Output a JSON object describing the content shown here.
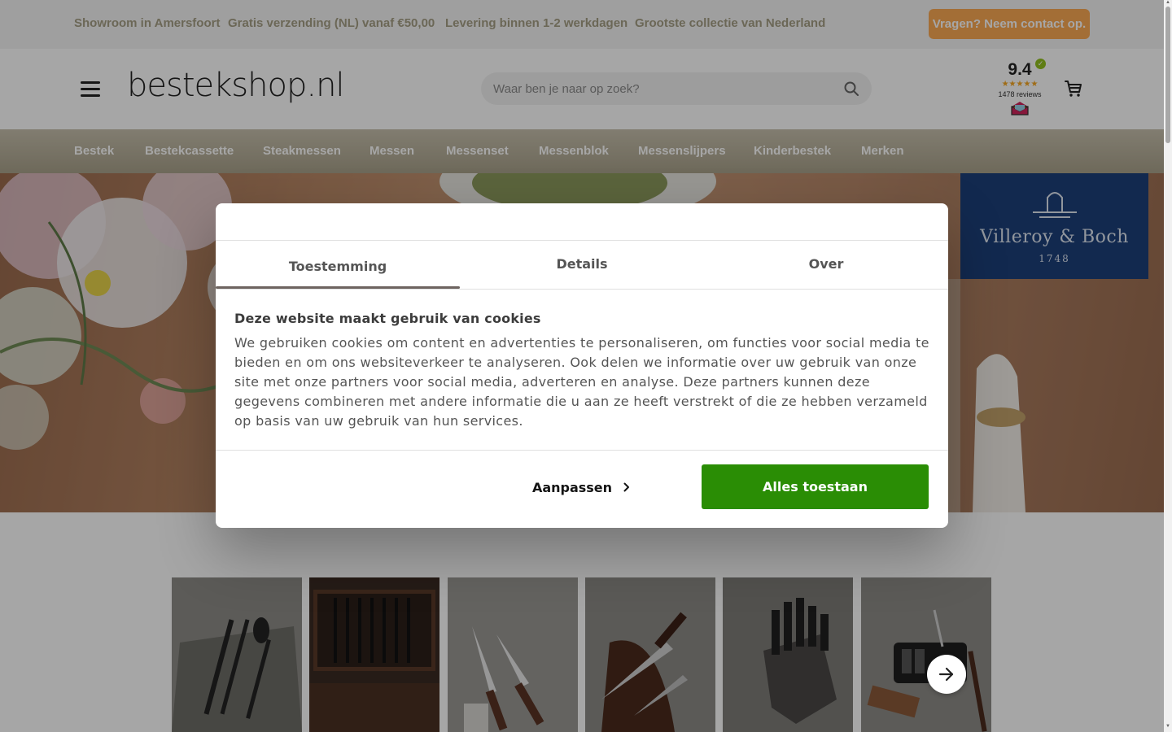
{
  "topbar": {
    "usps": [
      "Showroom in Amersfoort",
      "Gratis verzending (NL) vanaf €50,00",
      "Levering binnen 1-2 werkdagen",
      "Grootste collectie van Nederland"
    ],
    "contact_label": "Vragen? Neem contact op."
  },
  "header": {
    "logo": "bestekshop.nl",
    "search_placeholder": "Waar ben je naar op zoek?",
    "rating": {
      "score": "9.4",
      "stars": "★★★★★",
      "reviews": "1478 reviews"
    }
  },
  "nav": {
    "items": [
      "Bestek",
      "Bestekcassette",
      "Steakmessen",
      "Messen",
      "Messenset",
      "Messenblok",
      "Messenslijpers",
      "Kinderbestek",
      "Merken"
    ]
  },
  "hero": {
    "brand": {
      "name": "Villeroy & Boch",
      "year": "1748"
    }
  },
  "cookie_dialog": {
    "tabs": [
      "Toestemming",
      "Details",
      "Over"
    ],
    "active_tab": "Toestemming",
    "title": "Deze website maakt gebruik van cookies",
    "body": "We gebruiken cookies om content en advertenties te personaliseren, om functies voor social media te bieden en om ons websiteverkeer te analyseren. Ook delen we informatie over uw gebruik van onze site met onze partners voor social media, adverteren en analyse. Deze partners kunnen deze gegevens combineren met andere informatie die u aan ze heeft verstrekt of die ze hebben verzameld op basis van uw gebruik van hun services.",
    "customize_label": "Aanpassen",
    "allow_all_label": "Alles toestaan"
  },
  "colors": {
    "accent_orange": "#fba954",
    "nav_gold": "#b5ae98",
    "allow_green": "#2a8d05",
    "usp_text": "#a59e85"
  },
  "icons": [
    "hamburger-icon",
    "search-icon",
    "cart-icon",
    "chevron-right-icon",
    "arrow-right-icon"
  ]
}
